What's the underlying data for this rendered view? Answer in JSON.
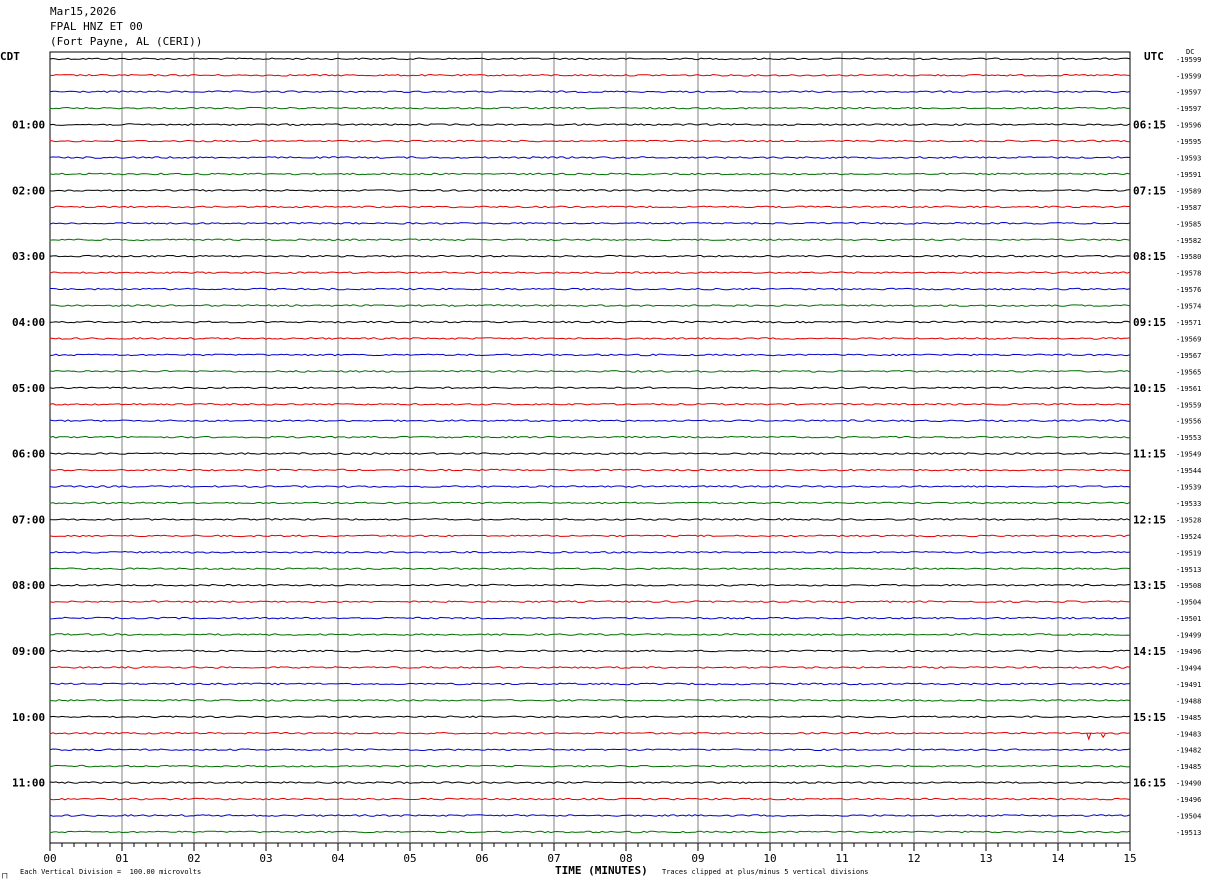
{
  "header": {
    "date": "Mar15,2026",
    "station": "FPAL HNZ ET 00",
    "location": "(Fort Payne, AL (CERI))"
  },
  "left_tz": "CDT",
  "right_tz": "UTC",
  "right_corner": "DC",
  "footer": {
    "xlabel": "TIME (MINUTES)",
    "scale_note": "Each Vertical Division =  100.00 microvolts",
    "clip_note": "Traces clipped at plus/minus 5 vertical divisions",
    "mark": "⨅"
  },
  "chart_data": {
    "type": "line",
    "title": "FPAL HNZ ET 00",
    "xlabel": "TIME (MINUTES)",
    "ylabel": "",
    "xlim": [
      0,
      15
    ],
    "x_ticks": [
      "00",
      "01",
      "02",
      "03",
      "04",
      "05",
      "06",
      "07",
      "08",
      "09",
      "10",
      "11",
      "12",
      "13",
      "14",
      "15"
    ],
    "trace_colors": [
      "#000000",
      "#e00000",
      "#0000cc",
      "#007000"
    ],
    "left_hour_labels": [
      "01:00",
      "02:00",
      "03:00",
      "04:00",
      "05:00",
      "06:00",
      "07:00",
      "08:00",
      "09:00",
      "10:00",
      "11:00"
    ],
    "right_hour_labels": [
      "06:15",
      "07:15",
      "08:15",
      "09:15",
      "10:15",
      "11:15",
      "12:15",
      "13:15",
      "14:15",
      "15:15",
      "16:15"
    ],
    "dc_offsets": [
      "-19599",
      "-19599",
      "-19597",
      "-19597",
      "-19596",
      "-19595",
      "-19593",
      "-19591",
      "-19589",
      "-19587",
      "-19585",
      "-19582",
      "-19580",
      "-19578",
      "-19576",
      "-19574",
      "-19571",
      "-19569",
      "-19567",
      "-19565",
      "-19561",
      "-19559",
      "-19556",
      "-19553",
      "-19549",
      "-19544",
      "-19539",
      "-19533",
      "-19528",
      "-19524",
      "-19519",
      "-19513",
      "-19508",
      "-19504",
      "-19501",
      "-19499",
      "-19496",
      "-19494",
      "-19491",
      "-19488",
      "-19485",
      "-19483",
      "-19482",
      "-19485",
      "-19490",
      "-19496",
      "-19504",
      "-19513"
    ],
    "event": {
      "trace_index": 41,
      "minute_start": 14.4,
      "minute_end": 14.6
    }
  }
}
